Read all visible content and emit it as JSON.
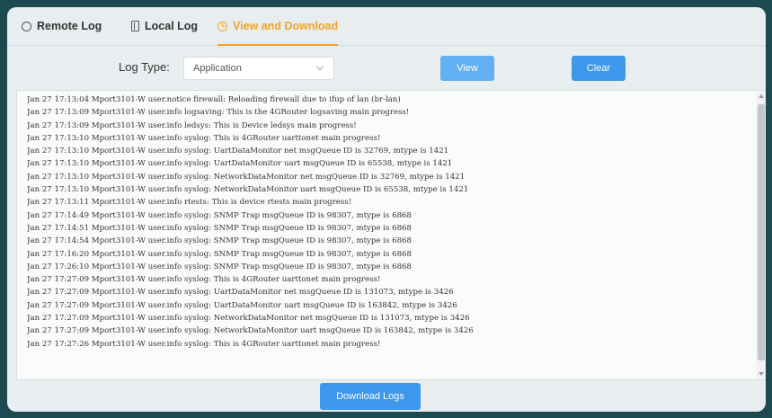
{
  "tabs": {
    "remote": {
      "label": "Remote Log",
      "icon": "circle-icon"
    },
    "local": {
      "label": "Local Log",
      "icon": "document-icon"
    },
    "view": {
      "label": "View and Download",
      "icon": "clock-icon",
      "active": true
    }
  },
  "filter": {
    "label": "Log Type:",
    "selected": "Application",
    "view_label": "View",
    "clear_label": "Clear"
  },
  "log": {
    "lines": [
      "Jan 27 17:13:04 Mport3101-W user.notice firewall: Reloading firewall due to ifup of lan (br-lan)",
      "Jan 27 17:13:09 Mport3101-W user.info logsaving: This is the 4GRouter logsaving main progress!",
      "Jan 27 17:13:09 Mport3101-W user.info ledsys: This is Device ledsys main progress!",
      "Jan 27 17:13:10 Mport3101-W user.info syslog: This is 4GRouter uarttonet main progress!",
      "Jan 27 17:13:10 Mport3101-W user.info syslog: UartDataMonitor net msgQueue ID is 32769, mtype is 1421",
      "Jan 27 17:13:10 Mport3101-W user.info syslog: UartDataMonitor uart msgQueue ID is 65538, mtype is 1421",
      "Jan 27 17:13:10 Mport3101-W user.info syslog: NetworkDataMonitor net msgQueue ID is 32769, mtype is 1421",
      "Jan 27 17:13:10 Mport3101-W user.info syslog: NetworkDataMonitor uart msgQueue ID is 65538, mtype is 1421",
      "Jan 27 17:13:11 Mport3101-W user.info rtests: This is device rtests main progress!",
      "Jan 27 17:14:49 Mport3101-W user.info syslog: SNMP Trap msgQueue ID is 98307, mtype is 6868",
      "Jan 27 17:14:51 Mport3101-W user.info syslog: SNMP Trap msgQueue ID is 98307, mtype is 6868",
      "Jan 27 17:14:54 Mport3101-W user.info syslog: SNMP Trap msgQueue ID is 98307, mtype is 6868",
      "Jan 27 17:16:20 Mport3101-W user.info syslog: SNMP Trap msgQueue ID is 98307, mtype is 6868",
      "Jan 27 17:26:10 Mport3101-W user.info syslog: SNMP Trap msgQueue ID is 98307, mtype is 6868",
      "Jan 27 17:27:09 Mport3101-W user.info syslog: This is 4GRouter uarttonet main progress!",
      "Jan 27 17:27:09 Mport3101-W user.info syslog: UartDataMonitor net msgQueue ID is 131073, mtype is 3426",
      "Jan 27 17:27:09 Mport3101-W user.info syslog: UartDataMonitor uart msgQueue ID is 163842, mtype is 3426",
      "Jan 27 17:27:09 Mport3101-W user.info syslog: NetworkDataMonitor net msgQueue ID is 131073, mtype is 3426",
      "Jan 27 17:27:09 Mport3101-W user.info syslog: NetworkDataMonitor uart msgQueue ID is 163842, mtype is 3426",
      "Jan 27 17:27:26 Mport3101-W user.info syslog: This is 4GRouter uarttonet main progress!"
    ]
  },
  "download": {
    "label": "Download Logs"
  },
  "colors": {
    "accent": "#f3a326",
    "button": "#3d97ea",
    "panel": "#e8eeef",
    "backdrop": "#1c4a50"
  }
}
